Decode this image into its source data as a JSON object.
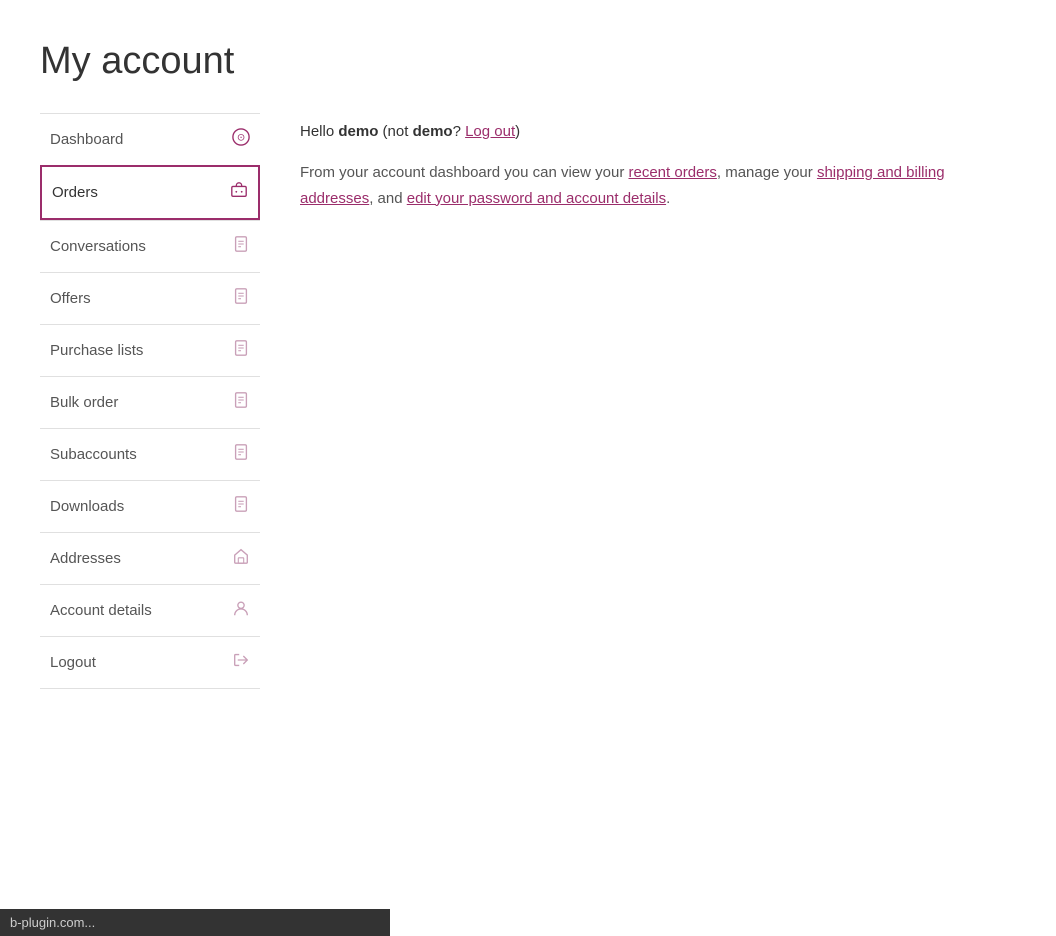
{
  "page": {
    "title": "My account"
  },
  "hello": {
    "prefix": "Hello ",
    "username": "demo",
    "not_prefix": " (not ",
    "not_username": "demo",
    "not_suffix": "? ",
    "logout_link": "Log out",
    "closing": ")"
  },
  "description": {
    "text_before": "From your account dashboard you can view your ",
    "recent_orders_link": "recent orders",
    "text_middle": ", manage your ",
    "shipping_link": "shipping and billing addresses",
    "text_and": ", and ",
    "password_link": "edit your password and account details",
    "text_end": "."
  },
  "sidebar": {
    "items": [
      {
        "id": "dashboard",
        "label": "Dashboard",
        "icon": "📊",
        "active": false
      },
      {
        "id": "orders",
        "label": "Orders",
        "icon": "🛒",
        "active": true
      },
      {
        "id": "conversations",
        "label": "Conversations",
        "icon": "📄",
        "active": false
      },
      {
        "id": "offers",
        "label": "Offers",
        "icon": "📄",
        "active": false
      },
      {
        "id": "purchase-lists",
        "label": "Purchase lists",
        "icon": "📄",
        "active": false
      },
      {
        "id": "bulk-order",
        "label": "Bulk order",
        "icon": "📄",
        "active": false
      },
      {
        "id": "subaccounts",
        "label": "Subaccounts",
        "icon": "📄",
        "active": false
      },
      {
        "id": "downloads",
        "label": "Downloads",
        "icon": "📄",
        "active": false
      },
      {
        "id": "addresses",
        "label": "Addresses",
        "icon": "🏠",
        "active": false
      },
      {
        "id": "account-details",
        "label": "Account details",
        "icon": "👤",
        "active": false
      },
      {
        "id": "logout",
        "label": "Logout",
        "icon": "➡",
        "active": false
      }
    ]
  },
  "status_bar": {
    "text": "b-plugin.com..."
  }
}
